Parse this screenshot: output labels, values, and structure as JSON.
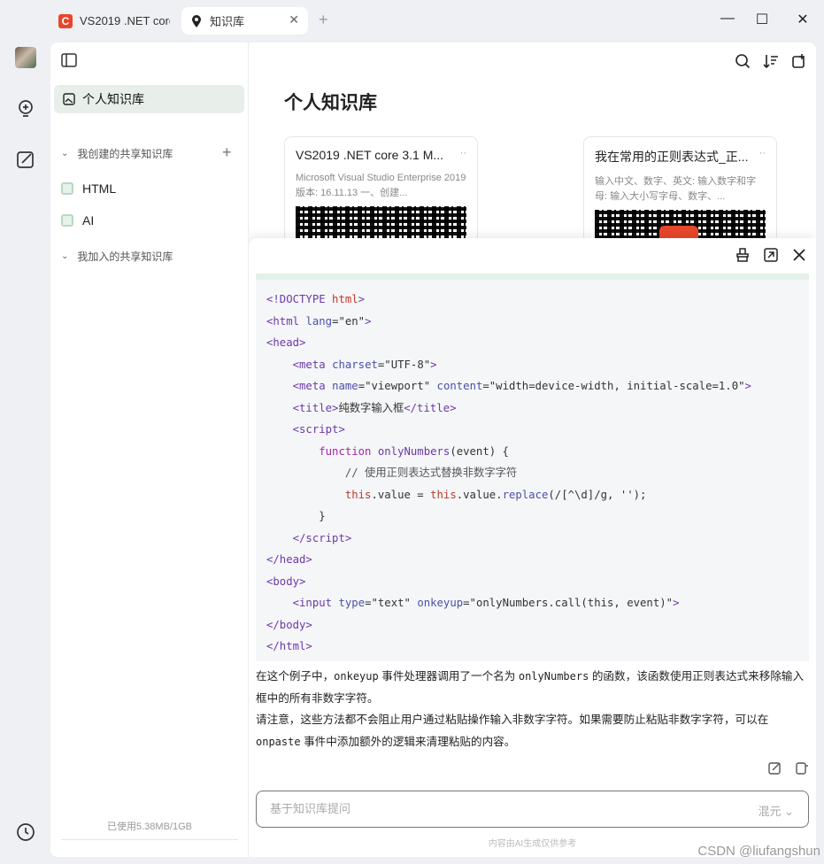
{
  "tabs": [
    {
      "label": "VS2019 .NET core",
      "icon": "csdn-logo-icon",
      "logo_letter": "C"
    },
    {
      "label": "知识库",
      "icon": "pin-icon"
    }
  ],
  "window_controls": {
    "minimize": "—",
    "maximize": "☐",
    "close": "✕"
  },
  "sidebar": {
    "active_item": "个人知识库",
    "created_section": "我创建的共享知识库",
    "created_items": [
      "HTML",
      "AI"
    ],
    "joined_section": "我加入的共享知识库",
    "usage": "已使用5.38MB/1GB"
  },
  "main": {
    "title": "个人知识库",
    "cards": [
      {
        "title": "VS2019 .NET core 3.1 M...",
        "desc": "Microsoft Visual Studio Enterprise 2019 版本: 16.11.13  一、创建...",
        "more": "··"
      },
      {
        "title": "我在常用的正则表达式_正...",
        "desc": "输入中文、数字、英文: 输入数字和字母: 输入大小写字母、数字、...",
        "more": "··"
      }
    ]
  },
  "answer": {
    "p1_a": "在这个例子中，",
    "p1_code1": "onkeyup",
    "p1_b": " 事件处理器调用了一个名为 ",
    "p1_code2": "onlyNumbers",
    "p1_c": " 的函数，该函数使用正则表达式来移除输入框中的所有非数字字符。",
    "p2_a": "请注意，这些方法都不会阻止用户通过粘贴操作输入非数字字符。如果需要防止粘贴非数字字符，可以在 ",
    "p2_code": "onpaste",
    "p2_b": " 事件中添加额外的逻辑来清理粘贴的内容。"
  },
  "ask": {
    "placeholder": "基于知识库提问",
    "model": "混元"
  },
  "disclaimer": "内容由AI生成仅供参考",
  "watermark": "CSDN @liufangshun",
  "colors": {
    "accent_green": "#e8efea",
    "brand_red": "#e8472b"
  }
}
